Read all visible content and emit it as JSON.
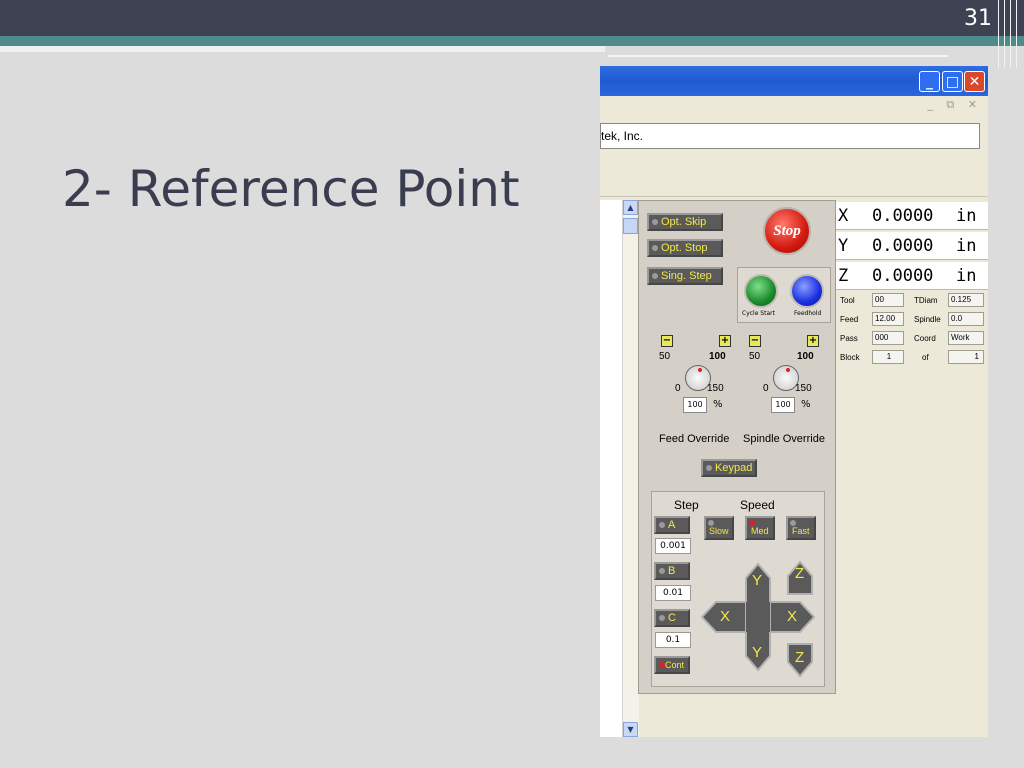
{
  "slide": {
    "number": "31",
    "title": "2- Reference Point"
  },
  "window": {
    "address_text": "tek, Inc.",
    "min_icon": "_",
    "max_icon": "□",
    "close_icon": "✕",
    "mdi_buttons": "_ ⧉ ✕"
  },
  "buttons": {
    "opt_skip": "Opt. Skip",
    "opt_stop": "Opt. Stop",
    "sing_step": "Sing. Step",
    "stop": "Stop",
    "cycle_start": "Cycle Start",
    "feedhold": "Feedhold",
    "keypad": "Keypad"
  },
  "feed_override": {
    "label": "Feed Override",
    "value": "100",
    "pct": "%",
    "s0": "0",
    "s50": "50",
    "s100": "100",
    "s150": "150",
    "minus": "−",
    "plus": "+"
  },
  "spindle_override": {
    "label": "Spindle Override",
    "value": "100",
    "pct": "%",
    "s0": "0",
    "s50": "50",
    "s100": "100",
    "s150": "150",
    "minus": "−",
    "plus": "+"
  },
  "jog": {
    "step_label": "Step",
    "speed_label": "Speed",
    "steps": [
      {
        "label": "A",
        "value": "0.001"
      },
      {
        "label": "B",
        "value": "0.01"
      },
      {
        "label": "C",
        "value": "0.1"
      }
    ],
    "cont_label": "Cont",
    "speeds": [
      "Slow",
      "Med",
      "Fast"
    ],
    "axes": {
      "y_up": "Y",
      "y_down": "Y",
      "x_left": "X",
      "x_right": "X",
      "z_up": "Z",
      "z_down": "Z"
    }
  },
  "dro": [
    {
      "axis": "X",
      "value": "0.0000",
      "unit": "in"
    },
    {
      "axis": "Y",
      "value": "0.0000",
      "unit": "in"
    },
    {
      "axis": "Z",
      "value": "0.0000",
      "unit": "in"
    }
  ],
  "info": {
    "tool_label": "Tool",
    "tool_value": "00",
    "tdiam_label": "TDiam",
    "tdiam_value": "0.125",
    "feed_label": "Feed",
    "feed_value": "12.00",
    "spindle_label": "Spindle",
    "spindle_value": "0.0",
    "pass_label": "Pass",
    "pass_value": "000",
    "coord_label": "Coord",
    "coord_value": "Work",
    "block_label": "Block",
    "block_value": "1",
    "of_label": "of",
    "of_value": "1"
  },
  "colors": {
    "topbar": "#3f4253",
    "teal": "#4d8c8a",
    "background": "#dcdcdc",
    "button_text": "#f4e84a",
    "stop": "#d41a10"
  }
}
